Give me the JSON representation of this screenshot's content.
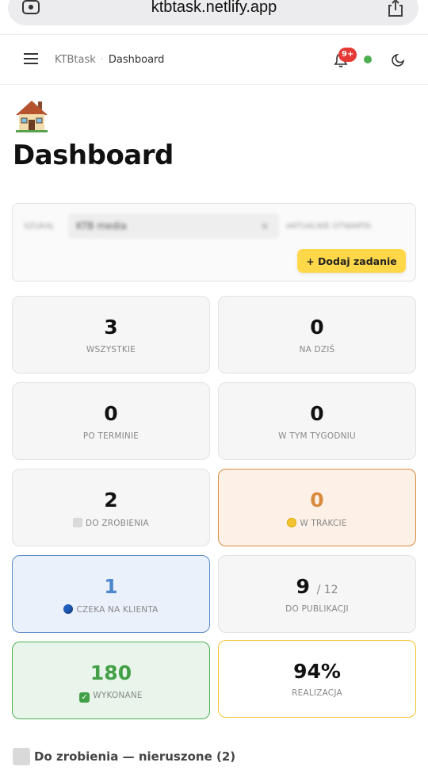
{
  "browser": {
    "url": "ktbtask.netlify.app"
  },
  "header": {
    "brand": "KTBtask",
    "separator": "·",
    "current_page": "Dashboard",
    "notification_badge": "9+"
  },
  "page": {
    "title": "Dashboard"
  },
  "filter": {
    "label_left": "SZUKAJ",
    "input_value": "KTB media",
    "input_clear": "×",
    "label_right": "AKTUALNIE OTWARTA",
    "add_button_label": "+ Dodaj zadanie"
  },
  "stats": [
    {
      "value": "3",
      "label": "WSZYSTKIE"
    },
    {
      "value": "0",
      "label": "NA DZIŚ"
    },
    {
      "value": "0",
      "label": "PO TERMINIE"
    },
    {
      "value": "0",
      "label": "W TYM TYGODNIU"
    },
    {
      "value": "2",
      "label": "DO ZROBIENIA"
    },
    {
      "value": "0",
      "label": "W TRAKCIE"
    },
    {
      "value": "1",
      "label": "CZEKA NA KLIENTA"
    },
    {
      "value": "9",
      "sub": "/ 12",
      "label": "DO PUBLIKACJI"
    },
    {
      "value": "180",
      "label": "WYKONANE"
    },
    {
      "value": "94%",
      "label": "REALIZACJA"
    }
  ],
  "section": {
    "title": "Do zrobienia — nieruszone (2)"
  },
  "colors": {
    "accent_yellow": "#ffd84a",
    "in_progress": "#d98a3f",
    "waiting": "#4d86cc",
    "done": "#43a047",
    "badge": "#e53935",
    "online": "#4caf50"
  }
}
